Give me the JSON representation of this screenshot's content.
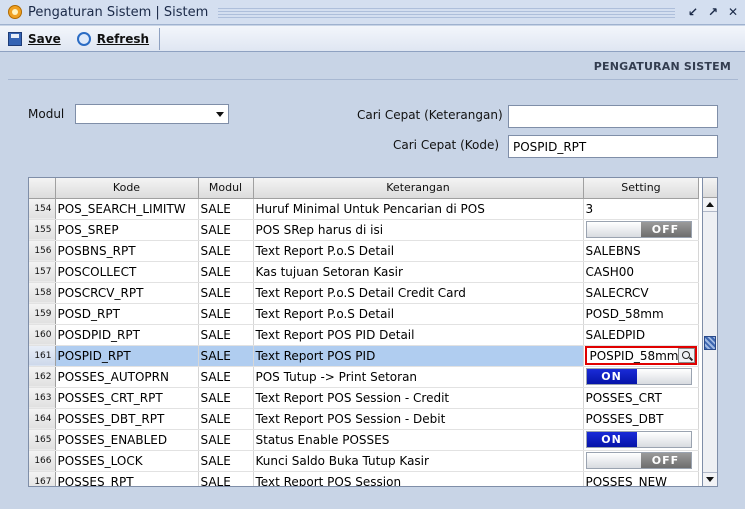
{
  "window": {
    "title": "Pengaturan Sistem | Sistem",
    "icon": "app-icon"
  },
  "toolbar": {
    "save_label": "Save",
    "refresh_label": "Refresh"
  },
  "header": {
    "section_title": "PENGATURAN SISTEM"
  },
  "filters": {
    "modul_label": "Modul",
    "modul_value": "",
    "cari_keterangan_label": "Cari Cepat (Keterangan)",
    "cari_keterangan_value": "",
    "cari_kode_label": "Cari Cepat (Kode)",
    "cari_kode_value": "POSPID_RPT"
  },
  "grid": {
    "columns": [
      "Kode",
      "Modul",
      "Keterangan",
      "Setting"
    ],
    "rows": [
      {
        "no": "154",
        "kode": "POS_SEARCH_LIMITW",
        "modul": "SALE",
        "keterangan": "Huruf Minimal Untuk Pencarian di POS",
        "setting": "3",
        "type": "text"
      },
      {
        "no": "155",
        "kode": "POS_SREP",
        "modul": "SALE",
        "keterangan": "POS SRep harus di isi",
        "setting": "OFF",
        "type": "toggle-off"
      },
      {
        "no": "156",
        "kode": "POSBNS_RPT",
        "modul": "SALE",
        "keterangan": "Text Report P.o.S Detail",
        "setting": "SALEBNS",
        "type": "text"
      },
      {
        "no": "157",
        "kode": "POSCOLLECT",
        "modul": "SALE",
        "keterangan": "Kas tujuan Setoran Kasir",
        "setting": "CASH00",
        "type": "text"
      },
      {
        "no": "158",
        "kode": "POSCRCV_RPT",
        "modul": "SALE",
        "keterangan": "Text Report P.o.S Detail Credit Card",
        "setting": "SALECRCV",
        "type": "text"
      },
      {
        "no": "159",
        "kode": "POSD_RPT",
        "modul": "SALE",
        "keterangan": "Text Report P.o.S Detail",
        "setting": "POSD_58mm",
        "type": "text"
      },
      {
        "no": "160",
        "kode": "POSDPID_RPT",
        "modul": "SALE",
        "keterangan": "Text Report POS PID Detail",
        "setting": "SALEDPID",
        "type": "text"
      },
      {
        "no": "161",
        "kode": "POSPID_RPT",
        "modul": "SALE",
        "keterangan": "Text Report POS PID",
        "setting": "POSPID_58mm",
        "type": "edit"
      },
      {
        "no": "162",
        "kode": "POSSES_AUTOPRN",
        "modul": "SALE",
        "keterangan": "POS Tutup -> Print Setoran",
        "setting": "ON",
        "type": "toggle-on"
      },
      {
        "no": "163",
        "kode": "POSSES_CRT_RPT",
        "modul": "SALE",
        "keterangan": "Text Report POS Session - Credit",
        "setting": "POSSES_CRT",
        "type": "text"
      },
      {
        "no": "164",
        "kode": "POSSES_DBT_RPT",
        "modul": "SALE",
        "keterangan": "Text Report POS Session - Debit",
        "setting": "POSSES_DBT",
        "type": "text"
      },
      {
        "no": "165",
        "kode": "POSSES_ENABLED",
        "modul": "SALE",
        "keterangan": "Status Enable POSSES",
        "setting": "ON",
        "type": "toggle-on"
      },
      {
        "no": "166",
        "kode": "POSSES_LOCK",
        "modul": "SALE",
        "keterangan": "Kunci Saldo Buka Tutup Kasir",
        "setting": "OFF",
        "type": "toggle-off"
      },
      {
        "no": "167",
        "kode": "POSSES_RPT",
        "modul": "SALE",
        "keterangan": "Text Report POS Session",
        "setting": "POSSES_NEW",
        "type": "text"
      }
    ],
    "selected_row": "161"
  },
  "colors": {
    "background": "#c8d4e6",
    "selected_row": "#b0cdf0",
    "toggle_on": "#0614a8",
    "toggle_off": "#6d6d6d",
    "edit_highlight": "#e00000"
  }
}
